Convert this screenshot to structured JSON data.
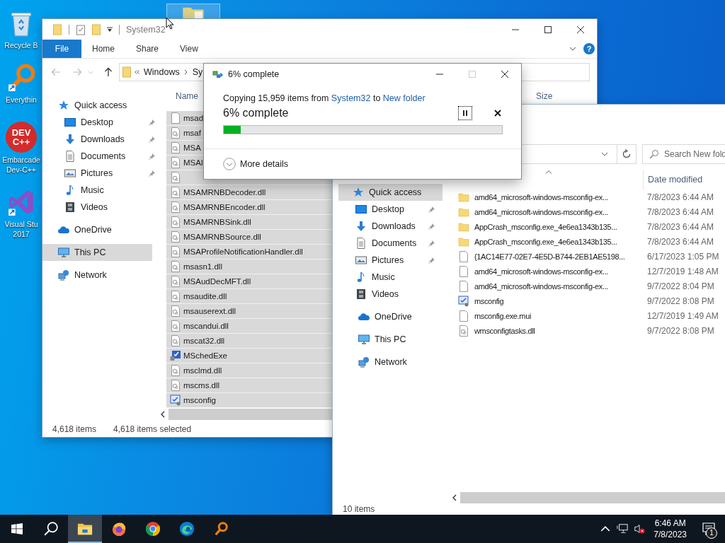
{
  "desktop": {
    "icons": [
      {
        "kind": "recycle-bin",
        "lines": [
          "Recycle B"
        ]
      },
      {
        "kind": "everything",
        "lines": [
          "Everythin"
        ]
      },
      {
        "kind": "dev-cpp",
        "logo_lines": [
          "DEV",
          "C++"
        ],
        "lines": [
          "Embarcade",
          "Dev-C++"
        ]
      },
      {
        "kind": "visual-studio",
        "lines": [
          "Visual Stu",
          "2017"
        ]
      }
    ]
  },
  "source_window": {
    "title": "System32",
    "ribbon_tabs": [
      {
        "label": "File",
        "kind": "file"
      },
      {
        "label": "Home",
        "kind": "tab"
      },
      {
        "label": "Share",
        "kind": "tab"
      },
      {
        "label": "View",
        "kind": "tab"
      }
    ],
    "help": "?",
    "breadcrumb": [
      "Windows",
      "Sy"
    ],
    "nav": [
      {
        "label": "Quick access",
        "kind": "star",
        "selected": false,
        "children": [
          {
            "label": "Desktop",
            "kind": "desktop",
            "pinned": true,
            "selected": false
          },
          {
            "label": "Downloads",
            "kind": "download",
            "pinned": true,
            "selected": false
          },
          {
            "label": "Documents",
            "kind": "document",
            "pinned": true,
            "selected": false
          },
          {
            "label": "Pictures",
            "kind": "image",
            "pinned": true,
            "selected": false
          },
          {
            "label": "Music",
            "kind": "music",
            "pinned": false,
            "selected": false
          },
          {
            "label": "Videos",
            "kind": "film",
            "pinned": false,
            "selected": false
          }
        ]
      },
      {
        "label": "OneDrive",
        "kind": "cloud",
        "selected": false
      },
      {
        "label": "This PC",
        "kind": "pc",
        "selected": true
      },
      {
        "label": "Network",
        "kind": "network",
        "selected": false
      }
    ],
    "columns": [
      "Name",
      "Size"
    ],
    "files": [
      {
        "name": "msad",
        "kind": "blank",
        "selected": true
      },
      {
        "name": "msaf",
        "kind": "dll",
        "selected": true
      },
      {
        "name": "MSA",
        "kind": "dll",
        "selected": true
      },
      {
        "name": "MSAl",
        "kind": "dll",
        "selected": true
      },
      {
        "kind": "dll",
        "selected": true
      },
      {
        "name": "MSAMRNBDecoder.dll",
        "kind": "dll",
        "selected": true
      },
      {
        "name": "MSAMRNBEncoder.dll",
        "kind": "dll",
        "selected": true
      },
      {
        "name": "MSAMRNBSink.dll",
        "kind": "dll",
        "selected": true
      },
      {
        "name": "MSAMRNBSource.dll",
        "kind": "dll",
        "selected": true
      },
      {
        "name": "MSAProfileNotificationHandler.dll",
        "kind": "dll",
        "selected": true
      },
      {
        "name": "msasn1.dll",
        "kind": "dll",
        "selected": true
      },
      {
        "name": "MSAudDecMFT.dll",
        "kind": "dll",
        "selected": true
      },
      {
        "name": "msaudite.dll",
        "kind": "dll",
        "selected": true
      },
      {
        "name": "msauserext.dll",
        "kind": "dll",
        "selected": true
      },
      {
        "name": "mscandui.dll",
        "kind": "dll",
        "selected": true
      },
      {
        "name": "mscat32.dll",
        "kind": "dll",
        "selected": true
      },
      {
        "name": "MSchedExe",
        "kind": "exe",
        "selected": true
      },
      {
        "name": "msclmd.dll",
        "kind": "dll",
        "selected": true
      },
      {
        "name": "mscms.dll",
        "kind": "dll",
        "selected": true
      },
      {
        "name": "msconfig",
        "kind": "config",
        "selected": true
      }
    ],
    "status": {
      "count": "4,618 items",
      "selection": "4,618 items selected"
    }
  },
  "copy_dialog": {
    "title": "6% complete",
    "status": {
      "prefix": "Copying 15,959 items from",
      "source": "System32",
      "joiner": "to",
      "destination": "New folder"
    },
    "heading": "6% complete",
    "level": 0.06,
    "paused": false,
    "maximize_disabled": true,
    "details_label": "More details"
  },
  "target_window": {
    "search_placeholder": "Search New fold",
    "sorted_ascending": true,
    "columns": [
      "Date modified"
    ],
    "nav": [
      {
        "label": "Quick access",
        "kind": "star",
        "selected": true,
        "children": [
          {
            "label": "Desktop",
            "kind": "desktop",
            "pinned": true,
            "selected": false
          },
          {
            "label": "Downloads",
            "kind": "download",
            "pinned": true,
            "selected": false
          },
          {
            "label": "Documents",
            "kind": "document",
            "pinned": true,
            "selected": false
          },
          {
            "label": "Pictures",
            "kind": "image",
            "pinned": true,
            "selected": false
          },
          {
            "label": "Music",
            "kind": "music",
            "pinned": false,
            "selected": false
          },
          {
            "label": "Videos",
            "kind": "film",
            "pinned": false,
            "selected": false
          }
        ]
      },
      {
        "label": "OneDrive",
        "kind": "cloud",
        "selected": false
      },
      {
        "label": "This PC",
        "kind": "pc",
        "selected": false
      },
      {
        "label": "Network",
        "kind": "network",
        "selected": false
      }
    ],
    "files": [
      {
        "name": "amd64_microsoft-windows-msconfig-ex...",
        "kind": "folder",
        "date": "7/8/2023 6:44 AM"
      },
      {
        "name": "amd64_microsoft-windows-msconfig-ex...",
        "kind": "folder",
        "date": "7/8/2023 6:44 AM"
      },
      {
        "name": "AppCrash_msconfig.exe_4e6ea1343b135...",
        "kind": "folder",
        "date": "7/8/2023 6:44 AM"
      },
      {
        "name": "AppCrash_msconfig.exe_4e6ea1343b135...",
        "kind": "folder",
        "date": "7/8/2023 6:44 AM"
      },
      {
        "name": "{1AC14E77-02E7-4E5D-B744-2EB1AE5198...",
        "kind": "blank",
        "date": "6/17/2023 1:05 PM"
      },
      {
        "name": "amd64_microsoft-windows-msconfig-ex...",
        "kind": "blank",
        "date": "12/7/2019 1:48 AM"
      },
      {
        "name": "amd64_microsoft-windows-msconfig-ex...",
        "kind": "blank",
        "date": "9/7/2022 8:04 PM"
      },
      {
        "name": "msconfig",
        "kind": "config",
        "date": "9/7/2022 8:08 PM"
      },
      {
        "name": "msconfig.exe.mui",
        "kind": "blank",
        "date": "12/7/2019 1:49 AM"
      },
      {
        "name": "wmsconfigtasks.dll",
        "kind": "dll",
        "date": "9/7/2022 8:08 PM"
      }
    ],
    "status": "10 items"
  },
  "taskbar": {
    "apps": [
      {
        "kind": "explorer",
        "active": true
      },
      {
        "kind": "firefox",
        "active": false
      },
      {
        "kind": "chrome",
        "active": false
      },
      {
        "kind": "edge",
        "active": false
      },
      {
        "kind": "everything",
        "active": false
      }
    ],
    "volume_muted": true,
    "time": "6:46 AM",
    "date": "7/8/2023",
    "notification_count": "1"
  }
}
